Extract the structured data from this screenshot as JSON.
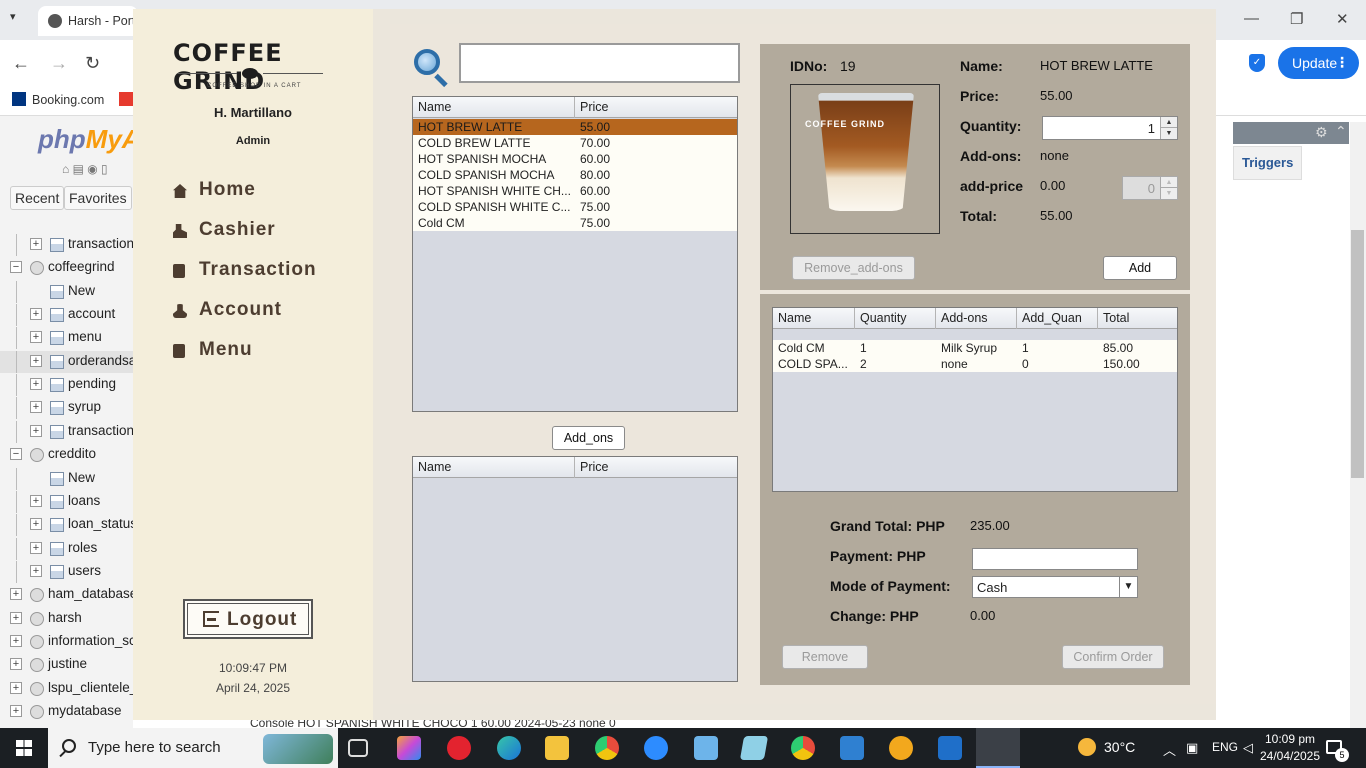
{
  "browser": {
    "tab_title": "Harsh - Port",
    "bookmarks": [
      "Booking.com"
    ],
    "update_label": "Update",
    "more_glyph": "⋮",
    "win_min": "—",
    "win_restore": "❐",
    "win_close": "✕",
    "icons": [
      "back-arrow-icon",
      "forward-arrow-icon",
      "reload-icon",
      "shield-icon"
    ]
  },
  "pma": {
    "logo_php": "php",
    "logo_my": "MyA",
    "recent_label": "Recent",
    "favorites_label": "Favorites",
    "tree": [
      {
        "label": "transaction",
        "level": 2,
        "kind": "table",
        "toggle": "+"
      },
      {
        "label": "coffeegrind",
        "level": 1,
        "kind": "db",
        "toggle": "−"
      },
      {
        "label": "New",
        "level": 2,
        "kind": "new",
        "toggle": ""
      },
      {
        "label": "account",
        "level": 2,
        "kind": "table",
        "toggle": "+"
      },
      {
        "label": "menu",
        "level": 2,
        "kind": "table",
        "toggle": "+"
      },
      {
        "label": "orderandsa",
        "level": 2,
        "kind": "table",
        "toggle": "+",
        "selected": true
      },
      {
        "label": "pending",
        "level": 2,
        "kind": "table",
        "toggle": "+"
      },
      {
        "label": "syrup",
        "level": 2,
        "kind": "table",
        "toggle": "+"
      },
      {
        "label": "transaction",
        "level": 2,
        "kind": "table",
        "toggle": "+"
      },
      {
        "label": "creddito",
        "level": 1,
        "kind": "db",
        "toggle": "−"
      },
      {
        "label": "New",
        "level": 2,
        "kind": "new",
        "toggle": ""
      },
      {
        "label": "loans",
        "level": 2,
        "kind": "table",
        "toggle": "+"
      },
      {
        "label": "loan_status",
        "level": 2,
        "kind": "table",
        "toggle": "+"
      },
      {
        "label": "roles",
        "level": 2,
        "kind": "table",
        "toggle": "+"
      },
      {
        "label": "users",
        "level": 2,
        "kind": "table",
        "toggle": "+"
      },
      {
        "label": "ham_database",
        "level": 1,
        "kind": "db",
        "toggle": "+"
      },
      {
        "label": "harsh",
        "level": 1,
        "kind": "db",
        "toggle": "+"
      },
      {
        "label": "information_sc",
        "level": 1,
        "kind": "db",
        "toggle": "+"
      },
      {
        "label": "justine",
        "level": 1,
        "kind": "db",
        "toggle": "+"
      },
      {
        "label": "lspu_clientele_",
        "level": 1,
        "kind": "db",
        "toggle": "+"
      },
      {
        "label": "mydatabase",
        "level": 1,
        "kind": "db",
        "toggle": "+"
      }
    ],
    "triggers_label": "Triggers",
    "bottom_row": "Console        HOT SPANISH WHITE CHOCO        1    60.00   2024-05-23   none                                   0"
  },
  "app": {
    "brand_title": "COFFEE GRIND",
    "brand_sub": "COFFEE SHOP IN A CART",
    "user_name": "H. Martillano",
    "user_role": "Admin",
    "nav": [
      {
        "label": "Home",
        "icon": "home-icon"
      },
      {
        "label": "Cashier",
        "icon": "cashier-icon"
      },
      {
        "label": "Transaction",
        "icon": "receipt-icon"
      },
      {
        "label": "Account",
        "icon": "user-icon"
      },
      {
        "label": "Menu",
        "icon": "menu-icon"
      }
    ],
    "logout_label": "Logout",
    "clock_time": "10:09:47 PM",
    "clock_date": "April 24, 2025",
    "search_value": "",
    "menu_table": {
      "columns": [
        "Name",
        "Price"
      ],
      "rows": [
        [
          "HOT BREW LATTE",
          "55.00"
        ],
        [
          "COLD BREW LATTE",
          "70.00"
        ],
        [
          "HOT SPANISH MOCHA",
          "60.00"
        ],
        [
          "COLD SPANISH MOCHA",
          "80.00"
        ],
        [
          "HOT SPANISH WHITE CH...",
          "60.00"
        ],
        [
          "COLD SPANISH WHITE C...",
          "75.00"
        ],
        [
          "Cold CM",
          "75.00"
        ]
      ],
      "selected_index": 0
    },
    "addons_button": "Add_ons",
    "addons_table": {
      "columns": [
        "Name",
        "Price"
      ],
      "rows": []
    },
    "detail": {
      "idno_label": "IDNo:",
      "idno_value": "19",
      "name_label": "Name:",
      "name_value": "HOT BREW LATTE",
      "price_label": "Price:",
      "price_value": "55.00",
      "qty_label": "Quantity:",
      "qty_value": "1",
      "addons_label": "Add-ons:",
      "addons_value": "none",
      "addprice_label": "add-price",
      "addprice_value": "0.00",
      "addprice_spin": "0",
      "total_label": "Total:",
      "total_value": "55.00",
      "cup_text": "COFFEE GRIND",
      "remove_addons_label": "Remove_add-ons",
      "add_label": "Add"
    },
    "order_table": {
      "columns": [
        "Name",
        "Quantity",
        "Add-ons",
        "Add_Quan",
        "Total"
      ],
      "rows": [
        [
          "Cold CM",
          "1",
          "Milk Syrup",
          "1",
          "85.00"
        ],
        [
          "COLD SPA...",
          "2",
          "none",
          "0",
          "150.00"
        ]
      ]
    },
    "summary": {
      "grand_total_label": "Grand Total: PHP",
      "grand_total_value": "235.00",
      "payment_label": "Payment: PHP",
      "payment_value": "",
      "mode_label": "Mode of Payment:",
      "mode_value": "Cash",
      "change_label": "Change: PHP",
      "change_value": "0.00",
      "remove_label": "Remove",
      "confirm_label": "Confirm Order"
    }
  },
  "taskbar": {
    "search_placeholder": "Type here to search",
    "weather": "30°C",
    "lang": "ENG",
    "time": "10:09 pm",
    "date": "24/04/2025",
    "notif_count": "5"
  },
  "colors": {
    "selected_row": "#b6661e",
    "detail_panel": "#b2aa9c",
    "sidebar": "#f4eedb",
    "accent_blue": "#1a73e8"
  }
}
